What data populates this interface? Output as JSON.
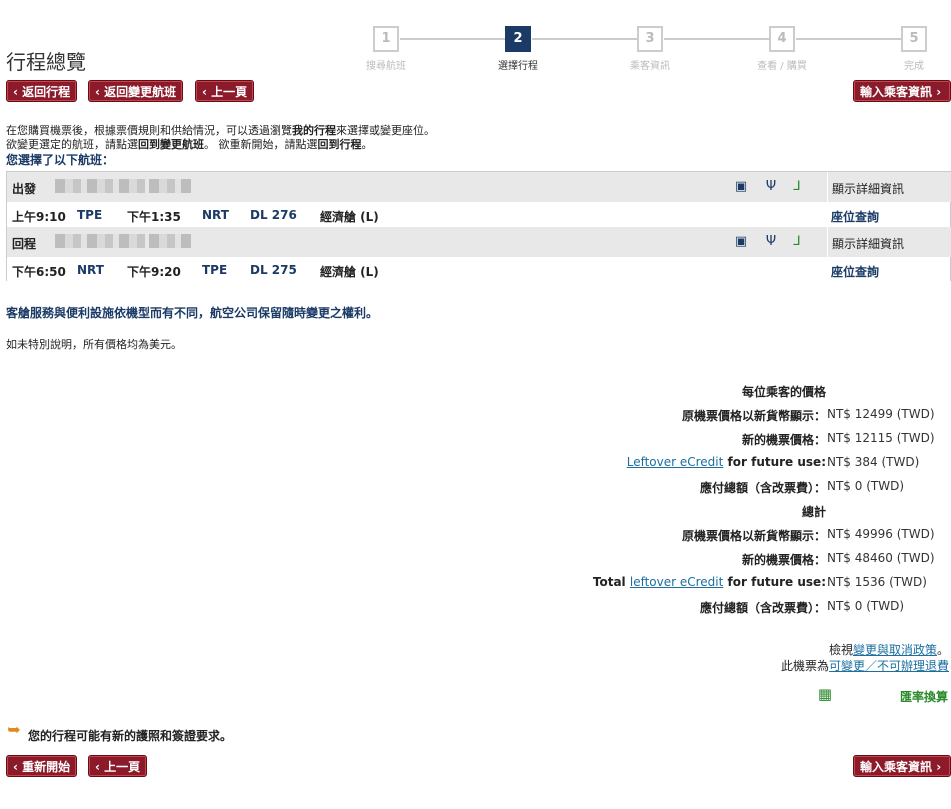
{
  "page_title": "行程總覽",
  "steps": [
    {
      "num": "1",
      "label": "搜尋航班",
      "active": false
    },
    {
      "num": "2",
      "label": "選擇行程",
      "active": true
    },
    {
      "num": "3",
      "label": "乘客資訊",
      "active": false
    },
    {
      "num": "4",
      "label": "查看 / 購買",
      "active": false
    },
    {
      "num": "5",
      "label": "完成",
      "active": false
    }
  ],
  "top_buttons": {
    "back_itinerary": "返回行程",
    "back_change": "返回變更航班",
    "prev": "上一頁",
    "enter_passenger": "輸入乘客資訊"
  },
  "intro": {
    "line1_a": "在您購買機票後，根據票價規則和供給情況，可以透過瀏覽",
    "line1_b": "我的行程",
    "line1_c": "來選擇或變更座位。",
    "line2_a": "欲變更選定的航班，請點選",
    "line2_b": "回到變更航班",
    "line2_c": "。 欲重新開始，請點選",
    "line2_d": "回到行程",
    "line2_e": "。",
    "selected": "您選擇了以下航班："
  },
  "flights": [
    {
      "direction": "出發",
      "depart_time": "上午9:10",
      "depart_airport": "TPE",
      "arrive_time": "下午1:35",
      "arrive_airport": "NRT",
      "flight": "DL 276",
      "cabin": "經濟艙 (L)",
      "details": "顯示詳細資訊",
      "seat": "座位查詢"
    },
    {
      "direction": "回程",
      "depart_time": "下午6:50",
      "depart_airport": "NRT",
      "arrive_time": "下午9:20",
      "arrive_airport": "TPE",
      "flight": "DL 275",
      "cabin": "經濟艙 (L)",
      "details": "顯示詳細資訊",
      "seat": "座位查詢"
    }
  ],
  "notice": {
    "cabin_note": "客艙服務與便利設施依機型而有不同，航空公司保留隨時變更之權利。",
    "currency_note": "如未特別說明，所有價格均為美元。"
  },
  "pricing": {
    "per_passenger_header": "每位乘客的價格",
    "per_passenger": [
      {
        "label": "原機票價格以新貨幣顯示：",
        "value": "NT$ 12499 (TWD)"
      },
      {
        "label": "新的機票價格：",
        "value": "NT$ 12115 (TWD)"
      },
      {
        "link": "Leftover eCredit",
        "label": "for future use:",
        "value": "NT$ 384 (TWD)"
      },
      {
        "label": "應付總額（含改票費）：",
        "value": "NT$ 0 (TWD)"
      }
    ],
    "total_header": "總計",
    "total": [
      {
        "label": "原機票價格以新貨幣顯示：",
        "value": "NT$ 49996 (TWD)"
      },
      {
        "label": "新的機票價格：",
        "value": "NT$ 48460 (TWD)"
      },
      {
        "prefix": "Total",
        "link": "leftover eCredit",
        "label": "for future use:",
        "value": "NT$ 1536 (TWD)"
      },
      {
        "label": "應付總額（含改票費）：",
        "value": "NT$ 0 (TWD)"
      }
    ]
  },
  "policy": {
    "view_prefix": "檢視",
    "view_link": "變更與取消政策",
    "view_suffix": "。",
    "ticket_prefix": "此機票為",
    "ticket_link": "可變更／不可辦理退費"
  },
  "currency_converter": "匯率換算",
  "passport_note": "您的行程可能有新的護照和簽證要求。",
  "bottom_buttons": {
    "restart": "重新開始",
    "prev": "上一頁",
    "enter_passenger": "輸入乘客資訊"
  },
  "colors": {
    "brand_red": "#8b1a2b",
    "navy": "#1b3b66",
    "link": "#1b6fa0",
    "green": "#2a8a2a"
  }
}
